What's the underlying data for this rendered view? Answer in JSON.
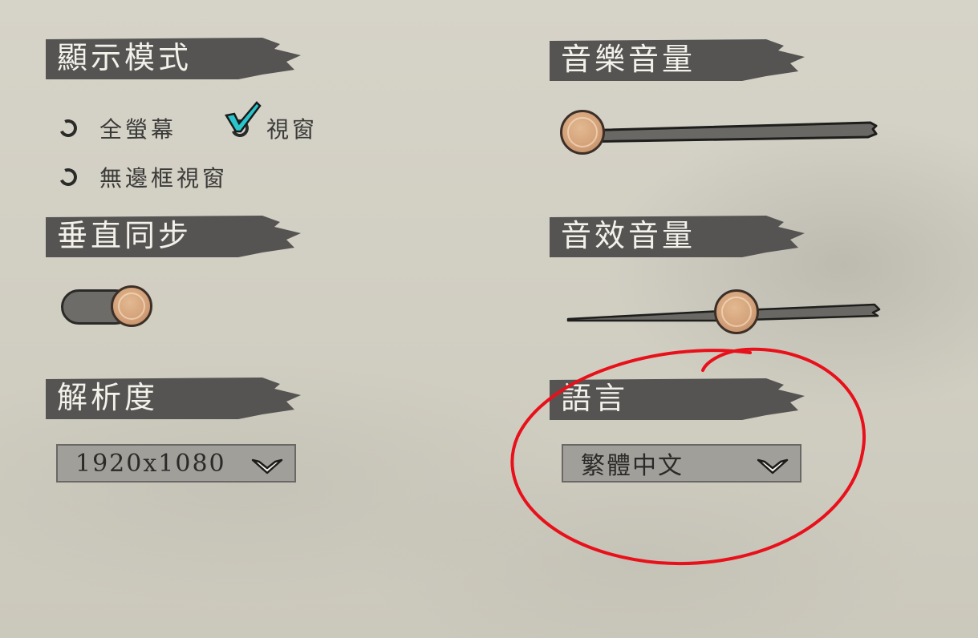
{
  "display_mode": {
    "title": "顯示模式",
    "options": [
      "全螢幕",
      "視窗",
      "無邊框視窗"
    ],
    "selected": "視窗"
  },
  "vsync": {
    "title": "垂直同步",
    "enabled": true
  },
  "resolution": {
    "title": "解析度",
    "value": "1920x1080"
  },
  "music_volume": {
    "title": "音樂音量",
    "level": 0.0
  },
  "sfx_volume": {
    "title": "音效音量",
    "level": 0.5
  },
  "language": {
    "title": "語言",
    "value": "繁體中文"
  },
  "colors": {
    "header_bar": "#555452",
    "check_accent": "#29c4cc",
    "annotation": "#e8101a",
    "knob": "#d4a27a"
  }
}
